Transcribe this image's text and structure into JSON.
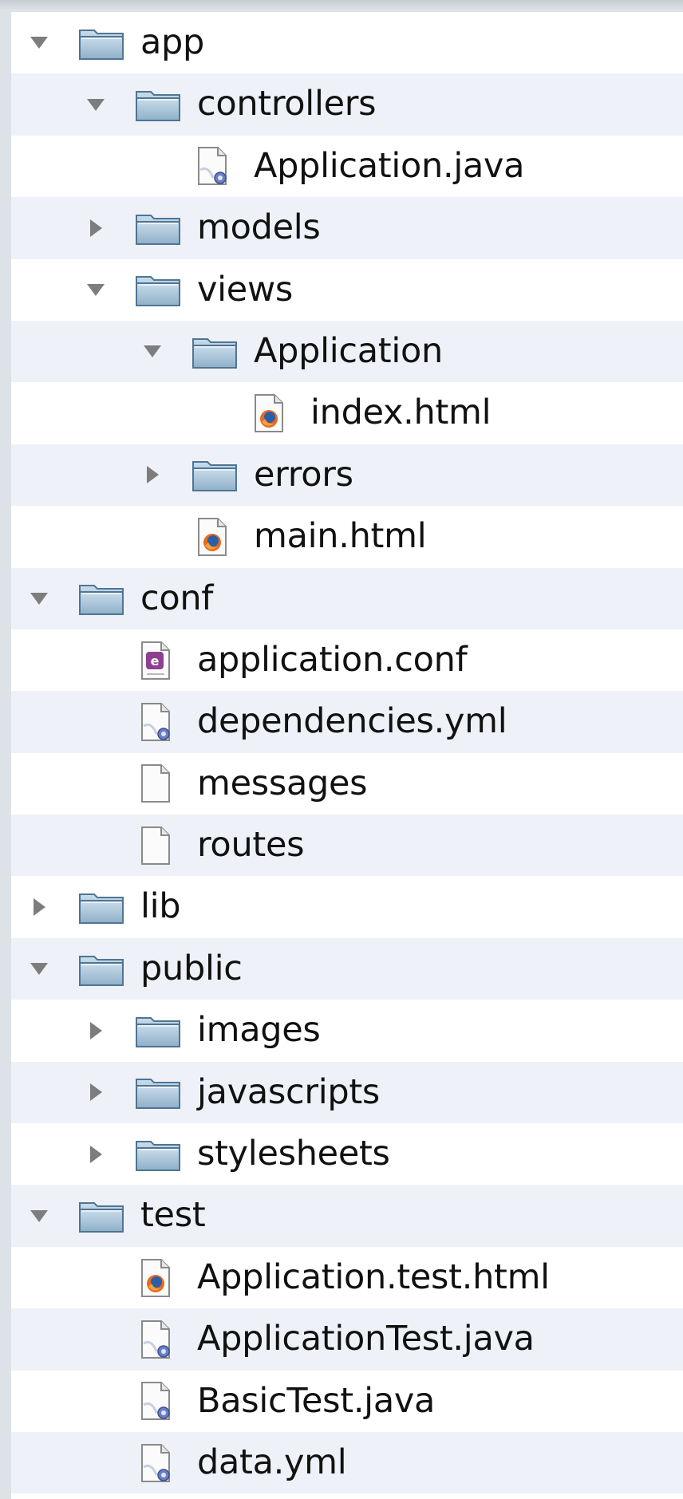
{
  "tree": [
    {
      "label": "app",
      "depth": 0,
      "kind": "folder",
      "expanded": true,
      "icon": "folder-icon"
    },
    {
      "label": "controllers",
      "depth": 1,
      "kind": "folder",
      "expanded": true,
      "icon": "folder-icon"
    },
    {
      "label": "Application.java",
      "depth": 2,
      "kind": "file",
      "icon": "java-file-icon"
    },
    {
      "label": "models",
      "depth": 1,
      "kind": "folder",
      "expanded": false,
      "icon": "folder-icon"
    },
    {
      "label": "views",
      "depth": 1,
      "kind": "folder",
      "expanded": true,
      "icon": "folder-icon"
    },
    {
      "label": "Application",
      "depth": 2,
      "kind": "folder",
      "expanded": true,
      "icon": "folder-icon"
    },
    {
      "label": "index.html",
      "depth": 3,
      "kind": "file",
      "icon": "html-file-icon"
    },
    {
      "label": "errors",
      "depth": 2,
      "kind": "folder",
      "expanded": false,
      "icon": "folder-icon"
    },
    {
      "label": "main.html",
      "depth": 2,
      "kind": "file",
      "icon": "html-file-icon"
    },
    {
      "label": "conf",
      "depth": 0,
      "kind": "folder",
      "expanded": true,
      "icon": "folder-icon"
    },
    {
      "label": "application.conf",
      "depth": 1,
      "kind": "file",
      "icon": "conf-file-icon"
    },
    {
      "label": "dependencies.yml",
      "depth": 1,
      "kind": "file",
      "icon": "java-file-icon"
    },
    {
      "label": "messages",
      "depth": 1,
      "kind": "file",
      "icon": "blank-file-icon"
    },
    {
      "label": "routes",
      "depth": 1,
      "kind": "file",
      "icon": "blank-file-icon"
    },
    {
      "label": "lib",
      "depth": 0,
      "kind": "folder",
      "expanded": false,
      "icon": "folder-icon"
    },
    {
      "label": "public",
      "depth": 0,
      "kind": "folder",
      "expanded": true,
      "icon": "folder-icon"
    },
    {
      "label": "images",
      "depth": 1,
      "kind": "folder",
      "expanded": false,
      "icon": "folder-icon"
    },
    {
      "label": "javascripts",
      "depth": 1,
      "kind": "folder",
      "expanded": false,
      "icon": "folder-icon"
    },
    {
      "label": "stylesheets",
      "depth": 1,
      "kind": "folder",
      "expanded": false,
      "icon": "folder-icon"
    },
    {
      "label": "test",
      "depth": 0,
      "kind": "folder",
      "expanded": true,
      "icon": "folder-icon"
    },
    {
      "label": "Application.test.html",
      "depth": 1,
      "kind": "file",
      "icon": "html-file-icon"
    },
    {
      "label": "ApplicationTest.java",
      "depth": 1,
      "kind": "file",
      "icon": "java-file-icon"
    },
    {
      "label": "BasicTest.java",
      "depth": 1,
      "kind": "file",
      "icon": "java-file-icon"
    },
    {
      "label": "data.yml",
      "depth": 1,
      "kind": "file",
      "icon": "java-file-icon"
    }
  ],
  "colors": {
    "row_alt": "#eef2f8",
    "disclosure": "#7d7d7d",
    "folder_top": "#c9dceb",
    "folder_bottom": "#8fb0c9"
  }
}
